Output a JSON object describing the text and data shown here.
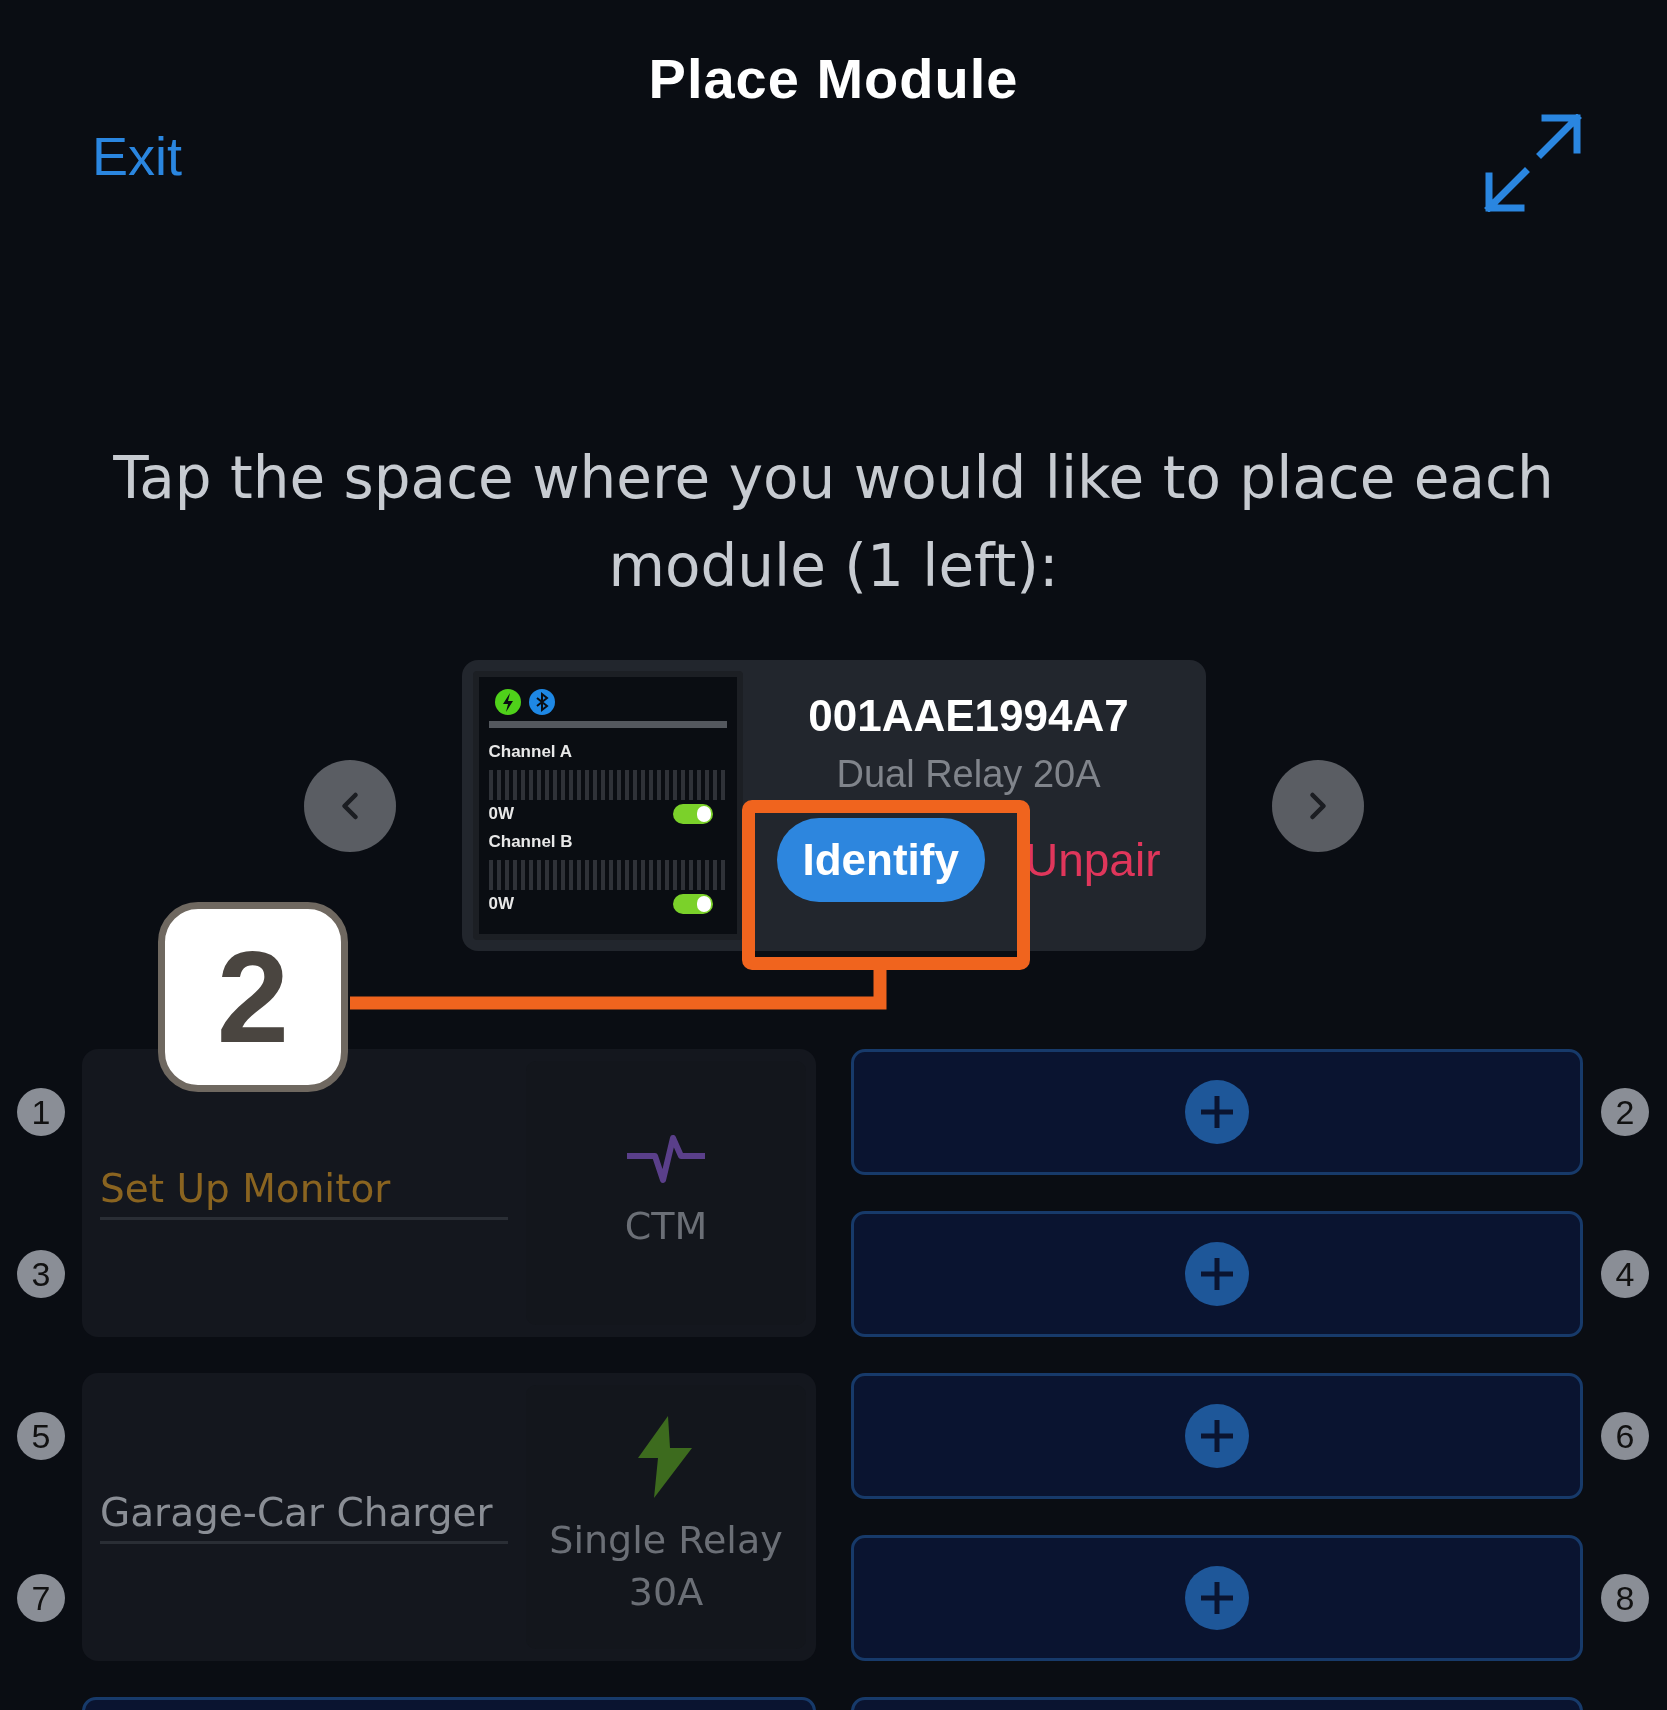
{
  "header": {
    "title": "Place Module",
    "exit": "Exit"
  },
  "instruction": "Tap the space where you would like to place each module (1 left):",
  "module": {
    "serial": "001AAE1994A7",
    "type": "Dual Relay 20A",
    "identify": "Identify",
    "unpair": "Unpair",
    "channels": [
      {
        "label": "Channel A",
        "reading": "0W",
        "on": true
      },
      {
        "label": "Channel B",
        "reading": "0W",
        "on": true
      }
    ]
  },
  "annotation": {
    "label": "2"
  },
  "left_column": [
    {
      "kind": "monitor",
      "numbers": [
        "1",
        "3"
      ],
      "name": {
        "placeholder": "Set Up Monitor"
      },
      "type": "CTM"
    },
    {
      "kind": "relay",
      "numbers": [
        "5",
        "7"
      ],
      "name": {
        "value": "Garage-Car Charger"
      },
      "type": "Single Relay 30A"
    },
    {
      "kind": "empty"
    }
  ],
  "right_column": [
    {
      "kind": "empty",
      "number": "2"
    },
    {
      "kind": "empty",
      "number": "4"
    },
    {
      "kind": "empty",
      "number": "6"
    },
    {
      "kind": "empty",
      "number": "8"
    },
    {
      "kind": "empty"
    }
  ]
}
